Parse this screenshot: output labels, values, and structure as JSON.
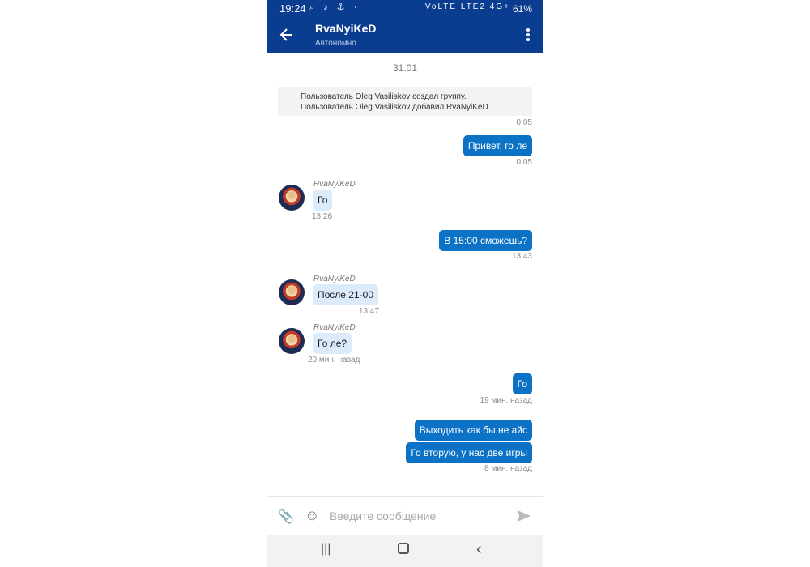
{
  "status_bar": {
    "time": "19:24",
    "left_icons": [
      "search-icon",
      "tiktok-icon",
      "app-icon",
      "dot"
    ],
    "network": "VoLTE LTE2 4G+",
    "battery": "61%"
  },
  "header": {
    "title": "RvaNyiKeD",
    "subtitle": "Автономно"
  },
  "chat": {
    "date": "31.01",
    "system_lines": [
      "Пользователь Oleg Vasiliskov создал группу.",
      "Пользователь Oleg Vasiliskov добавил RvaNyiKeD."
    ],
    "system_time": "0:05",
    "messages": [
      {
        "dir": "out",
        "text": "Привет, го ле",
        "time": "0:05"
      },
      {
        "dir": "in",
        "sender": "RvaNyiKeD",
        "text": "Го",
        "time": "13:26"
      },
      {
        "dir": "out",
        "text": "В 15:00 сможешь?",
        "time": "13:43"
      },
      {
        "dir": "in",
        "sender": "RvaNyiKeD",
        "text": "После 21-00",
        "time": "13:47"
      },
      {
        "dir": "in",
        "sender": "RvaNyiKeD",
        "text": "Го ле?",
        "time": "20 мин. назад"
      },
      {
        "dir": "out",
        "text": "Го",
        "time": "19 мин. назад"
      },
      {
        "dir": "out",
        "text": "Выходить как бы не айс",
        "time": ""
      },
      {
        "dir": "out",
        "text": "Го вторую, у нас две игры",
        "time": "8 мин. назад"
      }
    ]
  },
  "composer": {
    "placeholder": "Введите сообщение"
  },
  "colors": {
    "header": "#0a3d8f",
    "outgoing_bubble": "#0b72c5",
    "incoming_bubble": "#dcebfa"
  }
}
